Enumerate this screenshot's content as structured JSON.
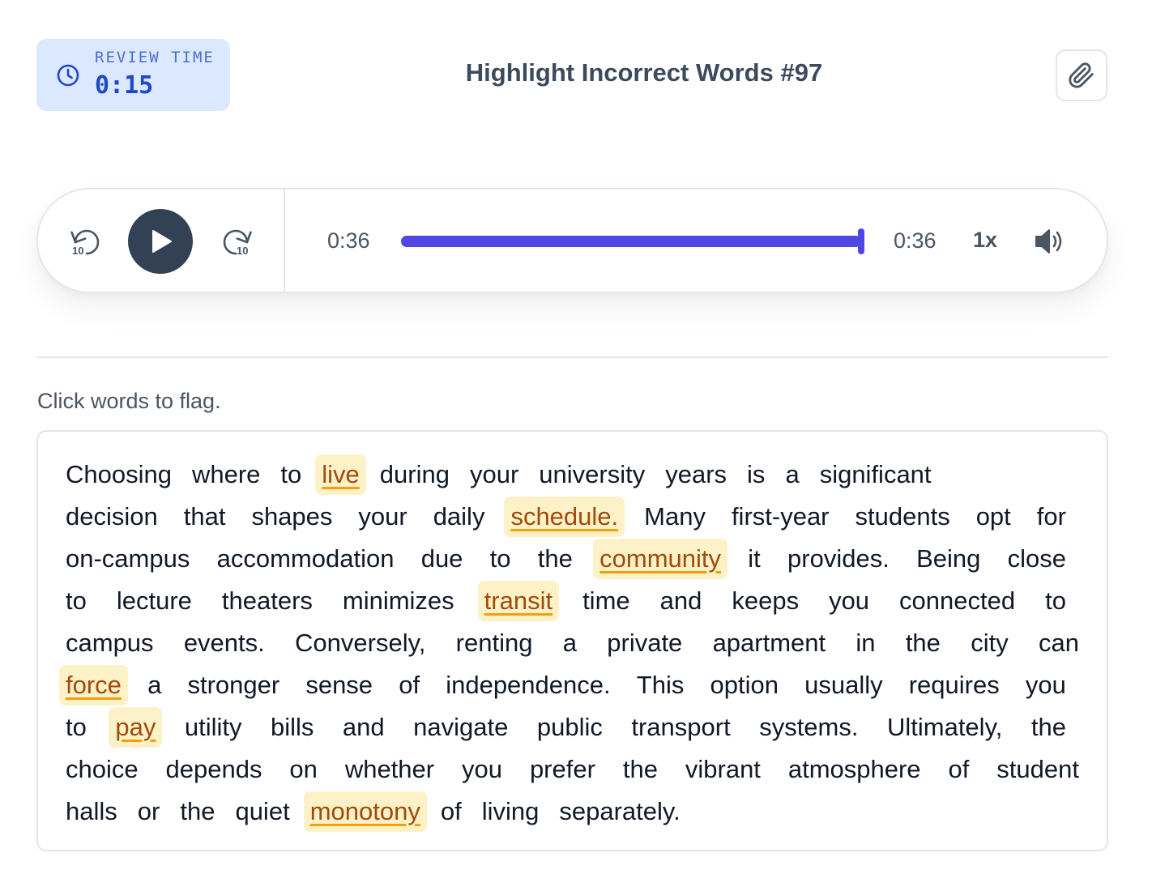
{
  "header": {
    "timer_label": "REVIEW TIME",
    "timer_value": "0:15",
    "title": "Highlight Incorrect Words #97"
  },
  "player": {
    "current_time": "0:36",
    "total_time": "0:36",
    "speed": "1x",
    "progress_fraction": 1.0
  },
  "instruction": "Click words to flag.",
  "text_lines": [
    [
      {
        "w": "Choosing"
      },
      {
        "w": "where"
      },
      {
        "w": "to"
      },
      {
        "w": "live",
        "flag": true
      },
      {
        "w": "during"
      },
      {
        "w": "your"
      },
      {
        "w": "university"
      },
      {
        "w": "years"
      },
      {
        "w": "is"
      },
      {
        "w": "a"
      },
      {
        "w": "significant"
      }
    ],
    [
      {
        "w": "decision"
      },
      {
        "w": "that"
      },
      {
        "w": "shapes"
      },
      {
        "w": "your"
      },
      {
        "w": "daily"
      },
      {
        "w": "schedule.",
        "flag": true
      },
      {
        "w": "Many"
      },
      {
        "w": "first-year"
      },
      {
        "w": "students"
      },
      {
        "w": "opt"
      },
      {
        "w": "for"
      }
    ],
    [
      {
        "w": "on-campus"
      },
      {
        "w": "accommodation"
      },
      {
        "w": "due"
      },
      {
        "w": "to"
      },
      {
        "w": "the"
      },
      {
        "w": "community",
        "flag": true
      },
      {
        "w": "it"
      },
      {
        "w": "provides."
      },
      {
        "w": "Being"
      },
      {
        "w": "close"
      }
    ],
    [
      {
        "w": "to"
      },
      {
        "w": "lecture"
      },
      {
        "w": "theaters"
      },
      {
        "w": "minimizes"
      },
      {
        "w": "transit",
        "flag": true
      },
      {
        "w": "time"
      },
      {
        "w": "and"
      },
      {
        "w": "keeps"
      },
      {
        "w": "you"
      },
      {
        "w": "connected"
      },
      {
        "w": "to"
      }
    ],
    [
      {
        "w": "campus"
      },
      {
        "w": "events."
      },
      {
        "w": "Conversely,"
      },
      {
        "w": "renting"
      },
      {
        "w": "a"
      },
      {
        "w": "private"
      },
      {
        "w": "apartment"
      },
      {
        "w": "in"
      },
      {
        "w": "the"
      },
      {
        "w": "city"
      },
      {
        "w": "can"
      }
    ],
    [
      {
        "w": "force",
        "flag": true
      },
      {
        "w": "a"
      },
      {
        "w": "stronger"
      },
      {
        "w": "sense"
      },
      {
        "w": "of"
      },
      {
        "w": "independence."
      },
      {
        "w": "This"
      },
      {
        "w": "option"
      },
      {
        "w": "usually"
      },
      {
        "w": "requires"
      },
      {
        "w": "you"
      }
    ],
    [
      {
        "w": "to"
      },
      {
        "w": "pay",
        "flag": true
      },
      {
        "w": "utility"
      },
      {
        "w": "bills"
      },
      {
        "w": "and"
      },
      {
        "w": "navigate"
      },
      {
        "w": "public"
      },
      {
        "w": "transport"
      },
      {
        "w": "systems."
      },
      {
        "w": "Ultimately,"
      },
      {
        "w": "the"
      }
    ],
    [
      {
        "w": "choice"
      },
      {
        "w": "depends"
      },
      {
        "w": "on"
      },
      {
        "w": "whether"
      },
      {
        "w": "you"
      },
      {
        "w": "prefer"
      },
      {
        "w": "the"
      },
      {
        "w": "vibrant"
      },
      {
        "w": "atmosphere"
      },
      {
        "w": "of"
      },
      {
        "w": "student"
      }
    ],
    [
      {
        "w": "halls"
      },
      {
        "w": "or"
      },
      {
        "w": "the"
      },
      {
        "w": "quiet"
      },
      {
        "w": "monotony",
        "flag": true
      },
      {
        "w": "of"
      },
      {
        "w": "living"
      },
      {
        "w": "separately."
      }
    ]
  ],
  "colors": {
    "accent": "#4f46e5",
    "flag_bg": "#fdf1c7",
    "flag_text": "#a14a0c",
    "flag_underline": "#f59e0b",
    "timer_bg": "#dbe8fe"
  },
  "icons": {
    "timer": "clock-icon",
    "attach": "paperclip-icon",
    "rewind": "rewind-10-icon",
    "play": "play-icon",
    "forward": "forward-10-icon",
    "volume": "volume-icon"
  }
}
